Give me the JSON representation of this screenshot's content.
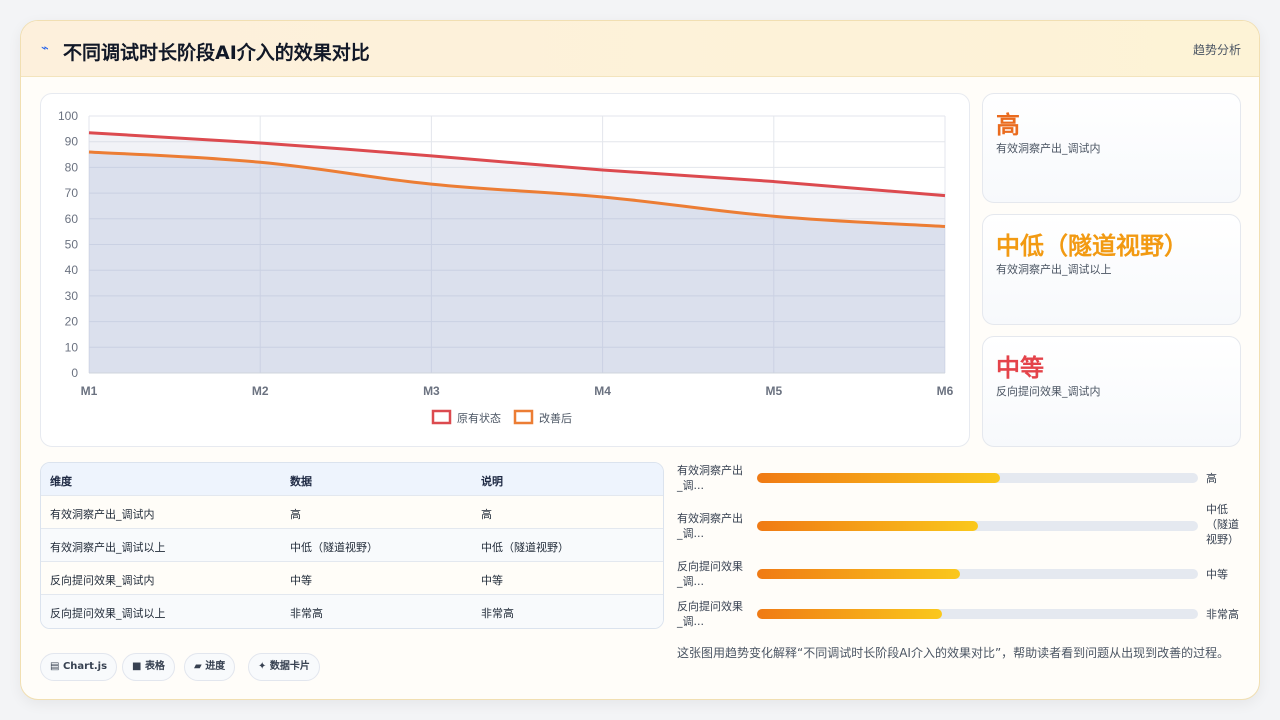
{
  "header": {
    "icon": "pulse-icon",
    "title": "不同调试时长阶段AI介入的效果对比",
    "link": "趋势分析"
  },
  "chart_data": {
    "type": "area",
    "categories": [
      "M1",
      "M2",
      "M3",
      "M4",
      "M5",
      "M6"
    ],
    "series": [
      {
        "name": "原有状态",
        "values": [
          93.5,
          89.5,
          84.5,
          79,
          74.5,
          69
        ],
        "color": "#dc4a4f"
      },
      {
        "name": "改善后",
        "values": [
          86,
          82,
          73.5,
          68.5,
          61,
          57
        ],
        "color": "#ec7d34"
      }
    ],
    "ylim": [
      0,
      100
    ],
    "yticks": [
      0,
      10,
      20,
      30,
      40,
      50,
      60,
      70,
      80,
      90,
      100
    ],
    "grid": true,
    "legend": "bottom"
  },
  "kpis": [
    {
      "value": "高",
      "label": "有效洞察产出_调试内",
      "color": "#ea6b1e"
    },
    {
      "value": "中低（隧道视野）",
      "label": "有效洞察产出_调试以上",
      "color": "#f29a12"
    },
    {
      "value": "中等",
      "label": "反向提问效果_调试内",
      "color": "#e4434a"
    }
  ],
  "table": {
    "headers": [
      "维度",
      "数据",
      "说明"
    ],
    "rows": [
      [
        "有效洞察产出_调试内",
        "高",
        "高"
      ],
      [
        "有效洞察产出_调试以上",
        "中低（隧道视野）",
        "中低（隧道视野）"
      ],
      [
        "反向提问效果_调试内",
        "中等",
        "中等"
      ],
      [
        "反向提问效果_调试以上",
        "非常高",
        "非常高"
      ]
    ]
  },
  "progress": [
    {
      "label_line1": "有效洞察产出",
      "label_line2": "_调...",
      "value_line1": "高",
      "value_line2": "",
      "value_line3": "",
      "fraction": 0.55
    },
    {
      "label_line1": "有效洞察产出",
      "label_line2": "_调...",
      "value_line1": "中低",
      "value_line2": "（隧道",
      "value_line3": "视野）",
      "fraction": 0.5
    },
    {
      "label_line1": "反向提问效果",
      "label_line2": "_调...",
      "value_line1": "中等",
      "value_line2": "",
      "value_line3": "",
      "fraction": 0.46
    },
    {
      "label_line1": "反向提问效果",
      "label_line2": "_调...",
      "value_line1": "非常高",
      "value_line2": "",
      "value_line3": "",
      "fraction": 0.42
    }
  ],
  "chips": [
    {
      "icon": "chart-icon",
      "glyph": "▤",
      "label": "Chart.js"
    },
    {
      "icon": "table-icon",
      "glyph": "■",
      "label": "表格"
    },
    {
      "icon": "progress-icon",
      "glyph": "▰",
      "label": "进度"
    },
    {
      "icon": "sparkle-icon",
      "glyph": "✦",
      "label": "数据卡片"
    }
  ],
  "note": "这张图用趋势变化解释“不同调试时长阶段AI介入的效果对比”，帮助读者看到问题从出现到改善的过程。"
}
